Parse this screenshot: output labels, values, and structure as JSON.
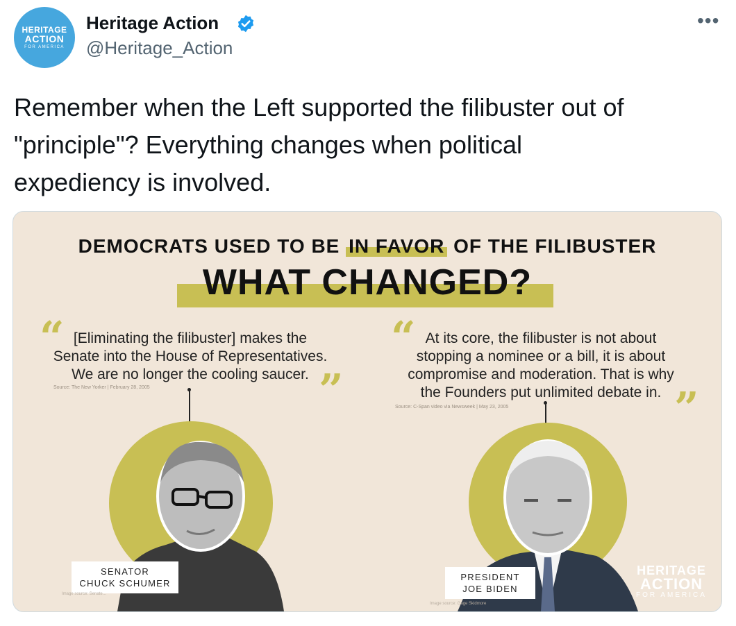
{
  "author": {
    "display_name": "Heritage Action",
    "handle": "@Heritage_Action",
    "avatar_text": [
      "HERITAGE",
      "ACTION",
      "FOR AMERICA"
    ],
    "verified": true
  },
  "more_label": "•••",
  "tweet": {
    "text": "Remember when the Left supported the filibuster out of\n\"principle\"? Everything changes when political\nexpediency is involved."
  },
  "graphic": {
    "headline_pre": "DEMOCRATS USED TO BE ",
    "headline_highlight": "IN FAVOR",
    "headline_post": " OF THE FILIBUSTER",
    "subheadline": "WHAT CHANGED?",
    "quotes": [
      {
        "text": "[Eliminating the filibuster] makes the\nSenate into the House of Representatives.\nWe are no longer the cooling saucer.",
        "source": "Source: The New Yorker | February 28, 2005",
        "label_line1": "SENATOR",
        "label_line2": "CHUCK SCHUMER",
        "image_credit": "Image source: Senate..."
      },
      {
        "text": "At its core, the filibuster is not about\nstopping a nominee or a bill, it is about\ncompromise and moderation. That is why\nthe Founders put unlimited debate in.",
        "source": "Source: C-Span video via Newsweek | May 23, 2005",
        "label_line1": "PRESIDENT",
        "label_line2": "JOE BIDEN",
        "image_credit": "Image source: Gage Skidmore"
      }
    ],
    "watermark": [
      "HERITAGE",
      "ACTION",
      "FOR AMERICA"
    ]
  },
  "colors": {
    "accent": "#c8bf54",
    "background": "#f1e6d9",
    "verified_blue": "#1d9bf0",
    "avatar_blue": "#46a7de"
  }
}
